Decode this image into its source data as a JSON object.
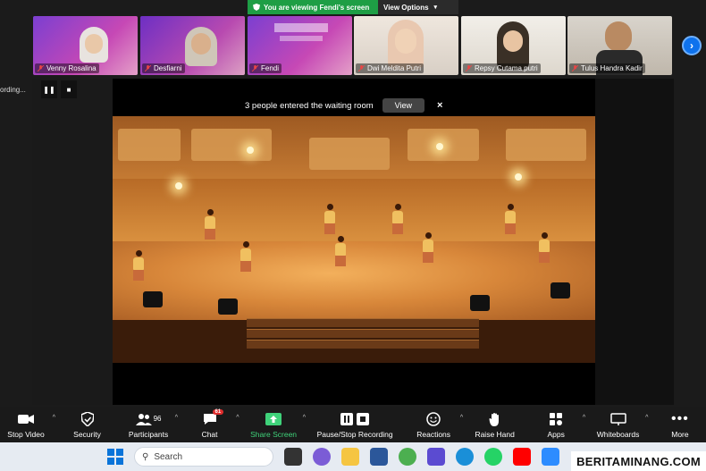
{
  "banner": {
    "viewing": "You are viewing Fendi's screen",
    "options": "View Options"
  },
  "participants": [
    {
      "name": "Venny Rosalina",
      "muted": true
    },
    {
      "name": "Desfiarni",
      "muted": true
    },
    {
      "name": "Fendi",
      "muted": true
    },
    {
      "name": "Dwi Meldita Putri",
      "muted": true
    },
    {
      "name": "Repsy Cutama putri",
      "muted": true
    },
    {
      "name": "Tulus Handra Kadir",
      "muted": true
    }
  ],
  "recording": {
    "label": "ording..."
  },
  "notification": {
    "text": "3 people entered the waiting room",
    "view_label": "View",
    "close": "×"
  },
  "toolbar": {
    "stop_video": "Stop Video",
    "security": "Security",
    "participants": "Participants",
    "participants_count": "96",
    "chat": "Chat",
    "chat_badge": "61",
    "share_screen": "Share Screen",
    "pause_stop": "Pause/Stop Recording",
    "reactions": "Reactions",
    "raise_hand": "Raise Hand",
    "apps": "Apps",
    "whiteboards": "Whiteboards",
    "more": "More"
  },
  "taskbar": {
    "search_placeholder": "Search"
  },
  "watermark": "BERITAMINANG.COM",
  "colors": {
    "accent": "#0e72ed",
    "green": "#1e9e45",
    "toolbar": "#1a1a1a"
  }
}
